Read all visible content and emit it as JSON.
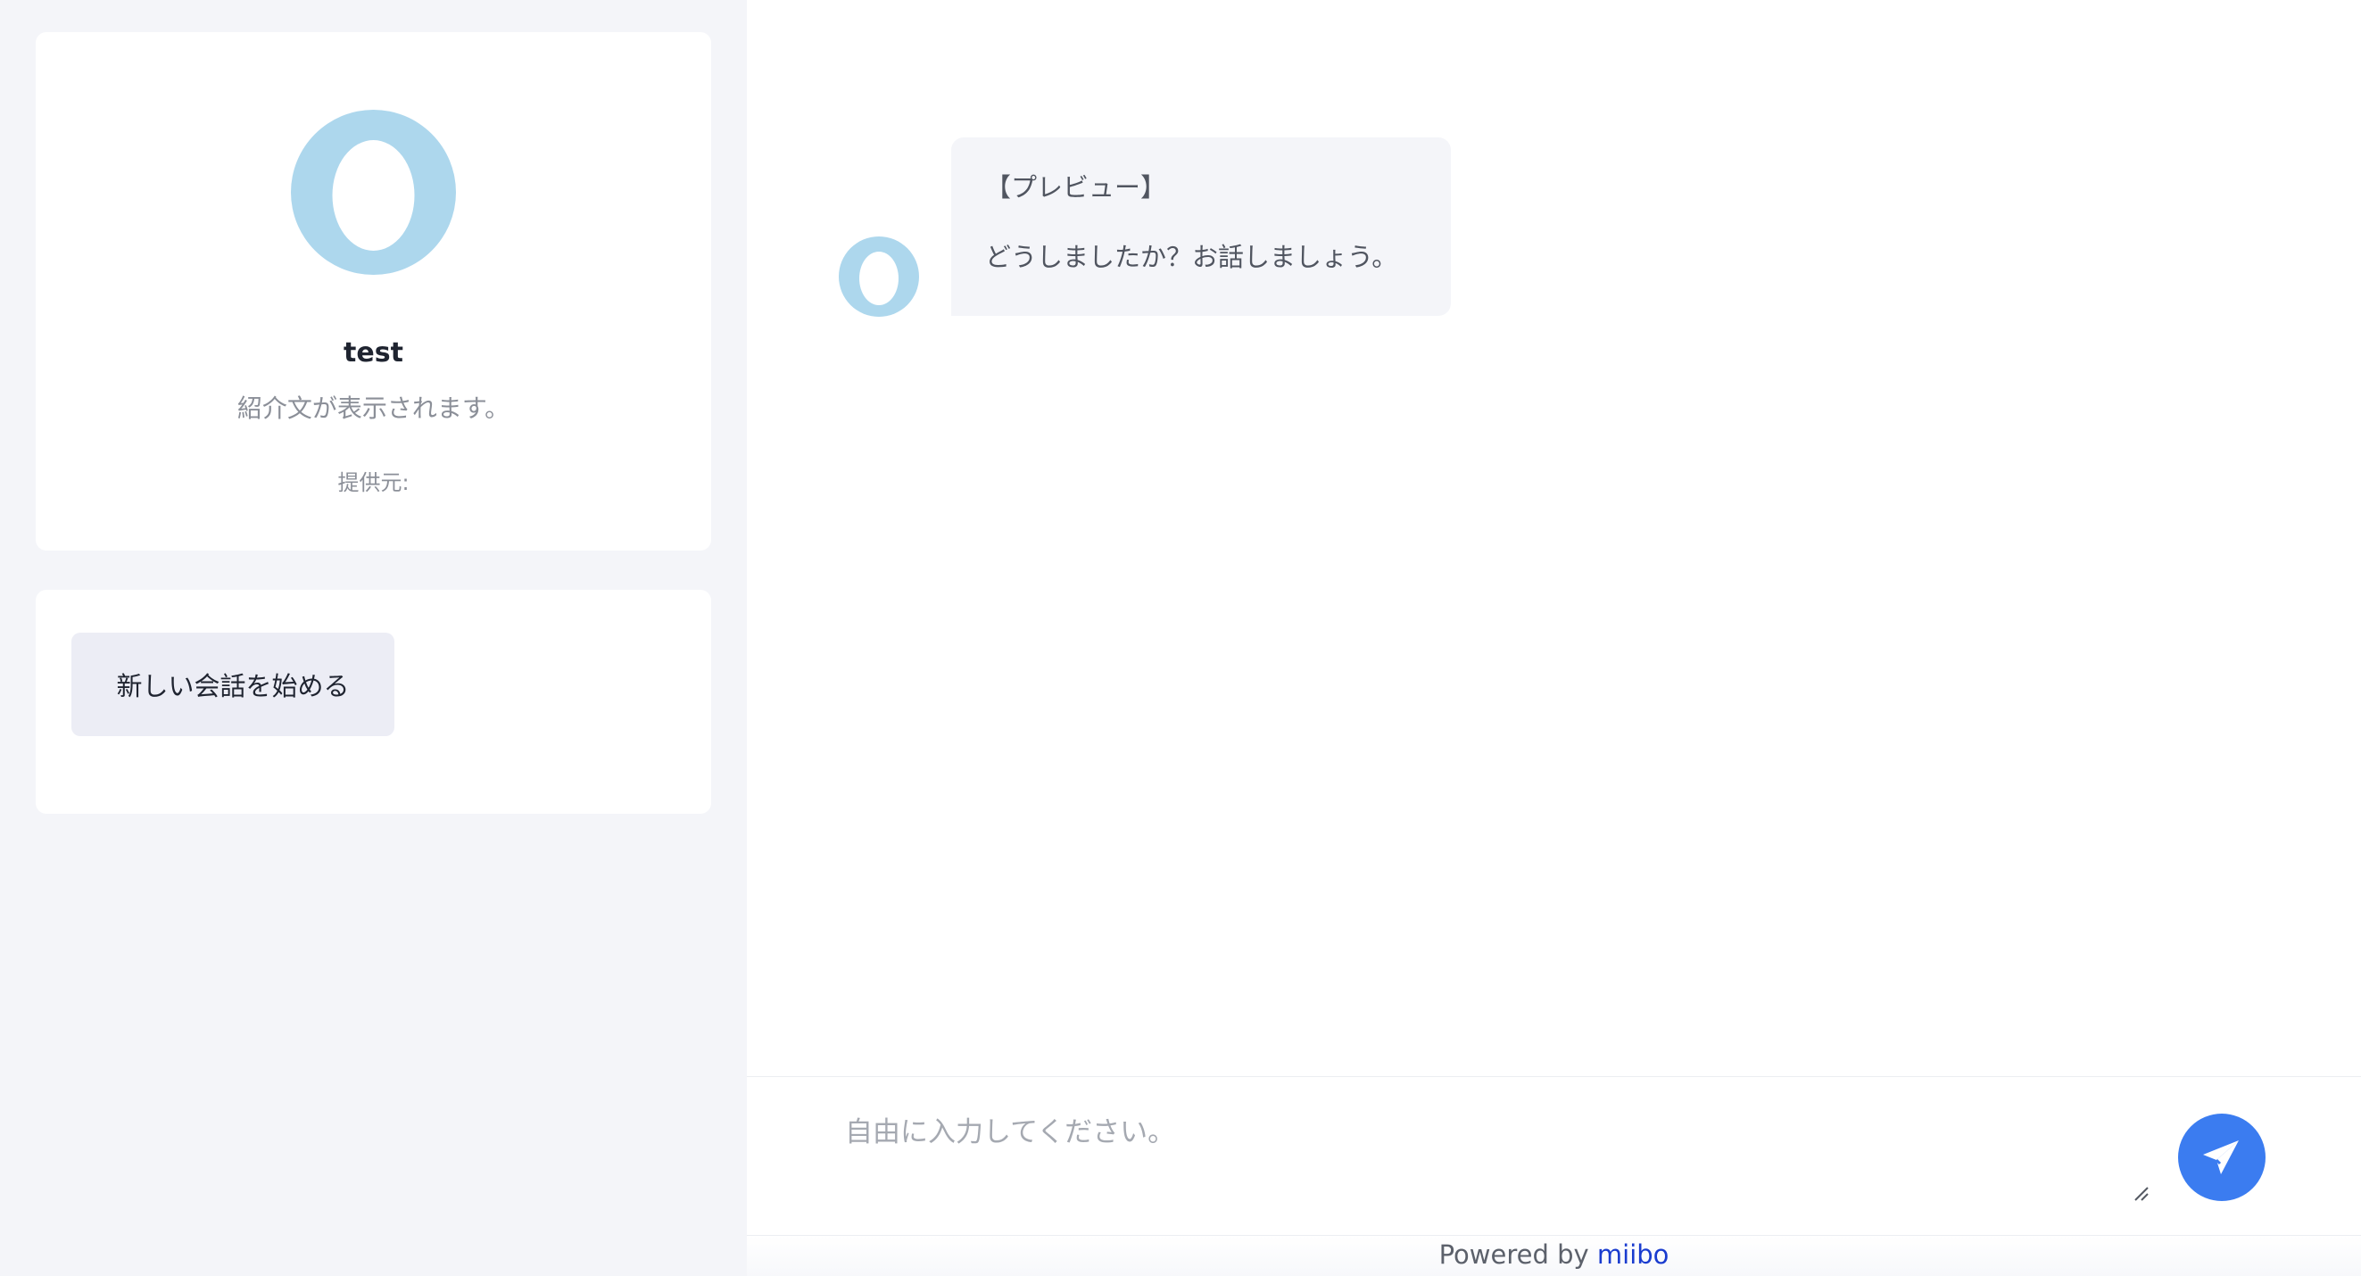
{
  "profile": {
    "name": "test",
    "description": "紹介文が表示されます。",
    "provider_label": "提供元:"
  },
  "actions": {
    "new_chat_label": "新しい会話を始める"
  },
  "chat": {
    "messages": [
      {
        "sender": "bot",
        "lines": [
          "【プレビュー】",
          "どうしましたか？お話しましょう。"
        ]
      }
    ]
  },
  "composer": {
    "placeholder": "自由に入力してください。",
    "value": ""
  },
  "footer": {
    "prefix": "Powered by",
    "brand": "miibo"
  },
  "colors": {
    "avatar": "#add7ed",
    "accent": "#3b7cf0",
    "sidebar_bg": "#f4f5f9",
    "brand_link": "#1a3ccf"
  },
  "icons": {
    "avatar": "egg-avatar-icon",
    "send": "paper-plane-icon",
    "resize": "resize-handle-icon"
  }
}
